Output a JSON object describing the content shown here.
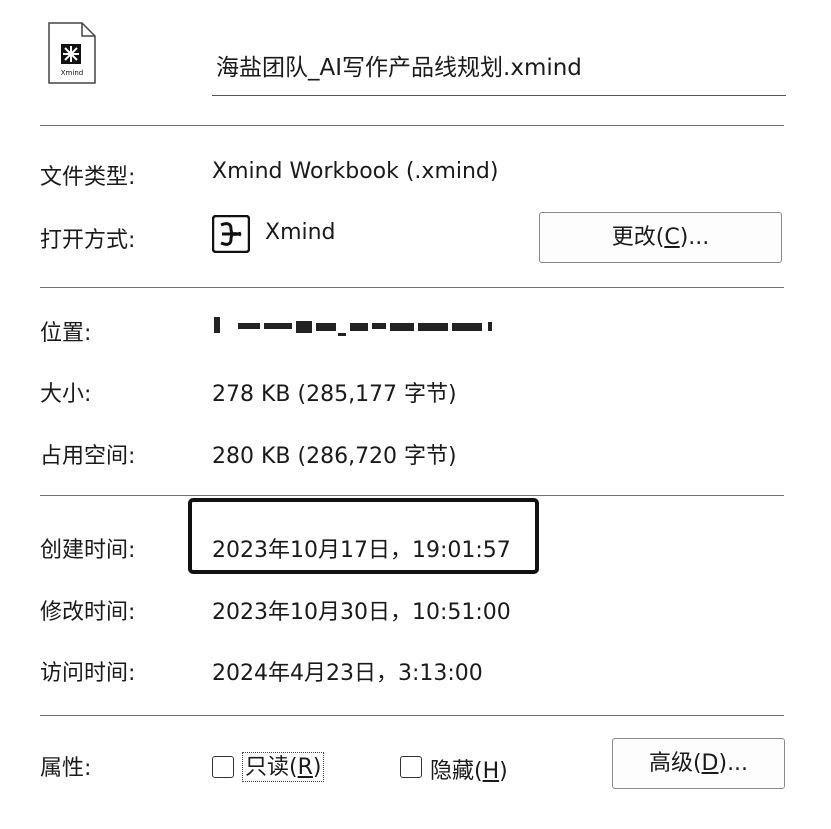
{
  "file": {
    "icon_name": "xmind-file-icon",
    "icon_caption": "Xmind",
    "name": "海盐团队_AI写作产品线规划.xmind"
  },
  "properties": {
    "type_label": "文件类型:",
    "type_value": "Xmind Workbook (.xmind)",
    "opens_with_label": "打开方式:",
    "opens_with_app": "Xmind",
    "change_button": {
      "text": "更改(",
      "hotkey": "C",
      "suffix": ")..."
    },
    "location_label": "位置:",
    "size_label": "大小:",
    "size_value": "278 KB (285,177 字节)",
    "size_on_disk_label": "占用空间:",
    "size_on_disk_value": "280 KB (286,720 字节)",
    "created_label": "创建时间:",
    "created_value": "2023年10月17日，19:01:57",
    "modified_label": "修改时间:",
    "modified_value": "2023年10月30日，10:51:00",
    "accessed_label": "访问时间:",
    "accessed_value": "2024年4月23日，3:13:00",
    "attributes_label": "属性:",
    "readonly": {
      "text": "只读(",
      "hotkey": "R",
      "suffix": ")",
      "checked": false
    },
    "hidden": {
      "text": "隐藏(",
      "hotkey": "H",
      "suffix": ")",
      "checked": false
    },
    "advanced_button": {
      "text": "高级(",
      "hotkey": "D",
      "suffix": ")..."
    }
  }
}
